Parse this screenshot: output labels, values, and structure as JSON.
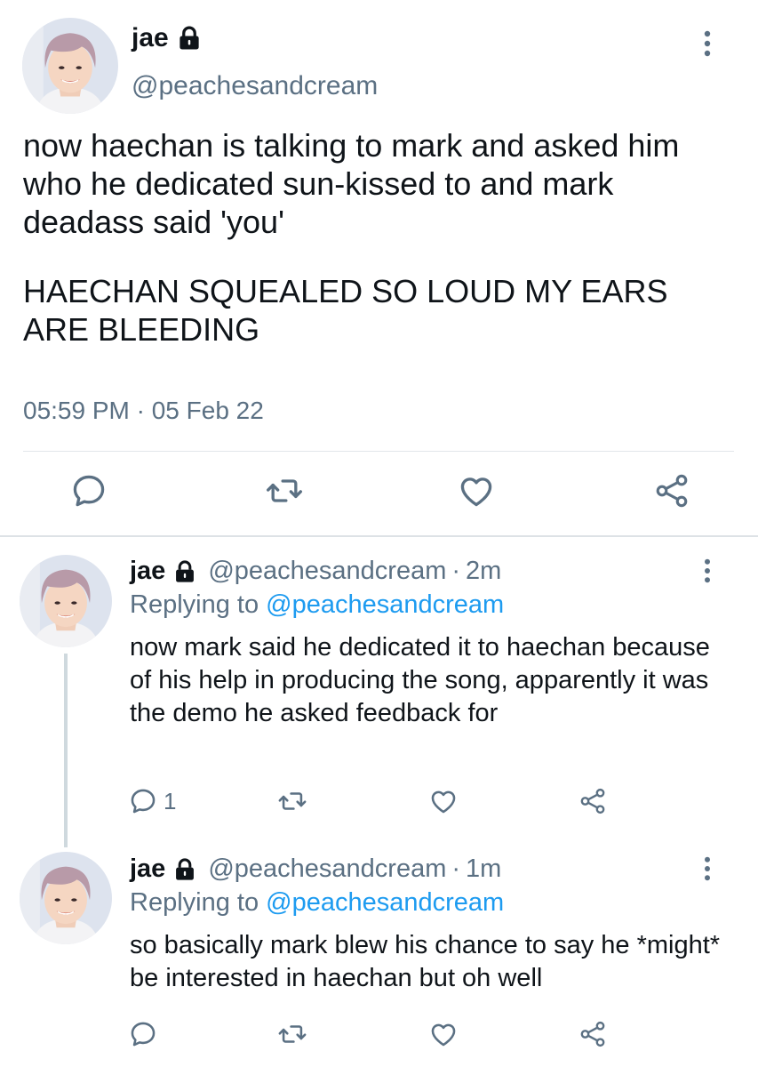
{
  "colors": {
    "text": "#0f1419",
    "secondary": "#5b7083",
    "link": "#1d9bf0",
    "divider": "#e2e6ea"
  },
  "main_tweet": {
    "name": "jae",
    "handle": "@peachesandcream",
    "paragraph1": "now haechan is talking to mark and asked him who he dedicated sun-kissed to and mark deadass said 'you'",
    "paragraph2": "HAECHAN SQUEALED SO LOUD MY EARS ARE BLEEDING",
    "timestamp": "05:59 PM · 05 Feb 22",
    "icons": [
      "lock-icon",
      "more-icon",
      "reply-icon",
      "retweet-icon",
      "like-icon",
      "share-icon"
    ]
  },
  "replies": [
    {
      "name": "jae",
      "handle": "@peachesandcream",
      "dot": "·",
      "time": "2m",
      "replying_prefix": "Replying to",
      "replying_to": "@peachesandcream",
      "text": "now mark said he dedicated it to haechan because of his help in producing the song, apparently it was the demo he asked feedback for",
      "reply_count": "1"
    },
    {
      "name": "jae",
      "handle": "@peachesandcream",
      "dot": "·",
      "time": "1m",
      "replying_prefix": "Replying to",
      "replying_to": "@peachesandcream",
      "text": "so basically mark blew his chance to say he *might* be interested in haechan but oh well",
      "reply_count": ""
    }
  ]
}
